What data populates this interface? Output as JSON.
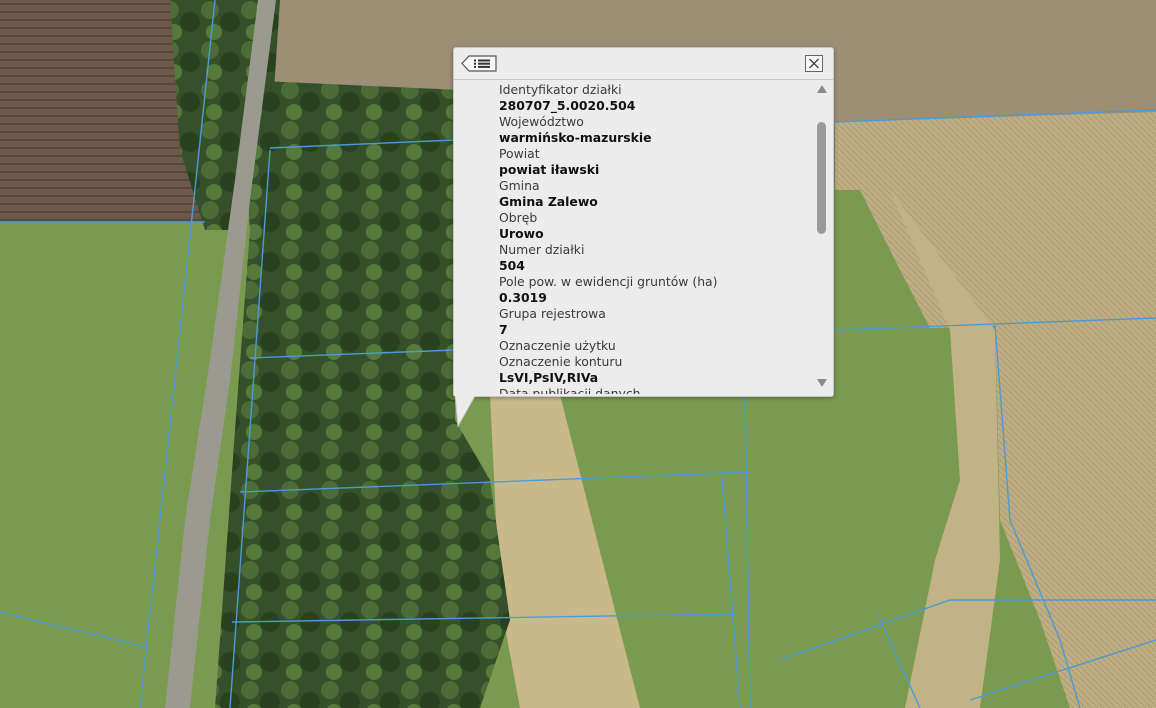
{
  "popup": {
    "back_icon": "list-back-icon",
    "close_icon": "close-icon",
    "fields": [
      {
        "label": "Identyfikator działki",
        "value": "280707_5.0020.504"
      },
      {
        "label": "Województwo",
        "value": "warmińsko-mazurskie"
      },
      {
        "label": "Powiat",
        "value": "powiat iławski"
      },
      {
        "label": "Gmina",
        "value": "Gmina Zalewo"
      },
      {
        "label": "Obręb",
        "value": "Urowo"
      },
      {
        "label": "Numer działki",
        "value": "504"
      },
      {
        "label": "Pole pow. w ewidencji gruntów (ha)",
        "value": "0.3019"
      },
      {
        "label": "Grupa rejestrowa",
        "value": "7"
      },
      {
        "label": "Oznaczenie użytku",
        "value": ""
      },
      {
        "label": "Oznaczenie konturu",
        "value": "LsVI,PsIV,RIVa"
      },
      {
        "label": "Data publikacji danych",
        "value": ""
      }
    ]
  },
  "map": {
    "parcel_line_color": "#4a9bd8",
    "description_colors": {
      "field": "#b9a678",
      "grass": "#7fa055",
      "forest": "#3c5a2c",
      "road": "#8c8c84"
    }
  }
}
